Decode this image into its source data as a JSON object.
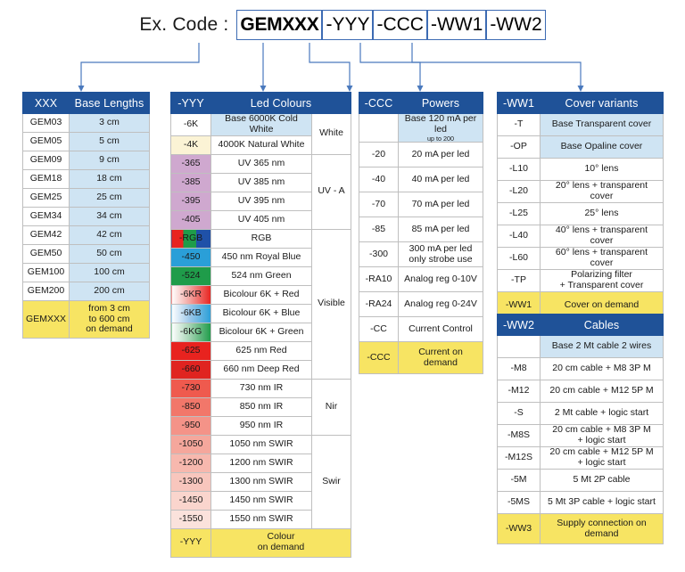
{
  "header": {
    "label": "Ex. Code :",
    "segments": [
      {
        "text": "GEMXXX",
        "bold": true
      },
      {
        "text": "-YYY",
        "bold": false
      },
      {
        "text": "-CCC",
        "bold": false
      },
      {
        "text": "-WW1",
        "bold": false
      },
      {
        "text": "-WW2",
        "bold": false
      }
    ]
  },
  "colors": {
    "header_blue": "#1f5298",
    "light_blue": "#cfe4f3",
    "yellow": "#f7e463",
    "connector_blue": "#3d6bb3",
    "uv_purple": "#cfa8cf",
    "red": "#e8231f",
    "green": "#1f9c4a",
    "blue": "#2a9fd8"
  },
  "tables": {
    "lengths": {
      "headers": [
        "XXX",
        "Base Lengths"
      ],
      "rows": [
        {
          "code": "GEM03",
          "desc": "3 cm"
        },
        {
          "code": "GEM05",
          "desc": "5 cm"
        },
        {
          "code": "GEM09",
          "desc": "9 cm"
        },
        {
          "code": "GEM18",
          "desc": "18 cm"
        },
        {
          "code": "GEM25",
          "desc": "25 cm"
        },
        {
          "code": "GEM34",
          "desc": "34 cm"
        },
        {
          "code": "GEM42",
          "desc": "42 cm"
        },
        {
          "code": "GEM50",
          "desc": "50 cm"
        },
        {
          "code": "GEM100",
          "desc": "100 cm"
        },
        {
          "code": "GEM200",
          "desc": "200 cm"
        }
      ],
      "demand": {
        "code": "GEMXXX",
        "desc": "from 3 cm\nto 600 cm\non demand"
      }
    },
    "colours": {
      "headers": [
        "-YYY",
        "Led Colours"
      ],
      "rows": [
        {
          "code": "-6K",
          "desc": "Base 6000K Cold White"
        },
        {
          "code": "-4K",
          "desc": "4000K Natural White"
        },
        {
          "code": "-365",
          "desc": "UV 365 nm"
        },
        {
          "code": "-385",
          "desc": "UV 385 nm"
        },
        {
          "code": "-395",
          "desc": "UV 395 nm"
        },
        {
          "code": "-405",
          "desc": "UV 405 nm"
        },
        {
          "code": "-RGB",
          "desc": "RGB"
        },
        {
          "code": "-450",
          "desc": "450 nm Royal Blue"
        },
        {
          "code": "-524",
          "desc": "524 nm Green"
        },
        {
          "code": "-6KR",
          "desc": "Bicolour 6K + Red"
        },
        {
          "code": "-6KB",
          "desc": "Bicolour 6K + Blue"
        },
        {
          "code": "-6KG",
          "desc": "Bicolour 6K + Green"
        },
        {
          "code": "-625",
          "desc": "625 nm Red"
        },
        {
          "code": "-660",
          "desc": "660 nm Deep Red"
        },
        {
          "code": "-730",
          "desc": "730 nm IR"
        },
        {
          "code": "-850",
          "desc": "850 nm IR"
        },
        {
          "code": "-950",
          "desc": "950 nm IR"
        },
        {
          "code": "-1050",
          "desc": "1050 nm SWIR"
        },
        {
          "code": "-1200",
          "desc": "1200 nm SWIR"
        },
        {
          "code": "-1300",
          "desc": "1300 nm SWIR"
        },
        {
          "code": "-1450",
          "desc": "1450 nm SWIR"
        },
        {
          "code": "-1550",
          "desc": "1550 nm SWIR"
        }
      ],
      "groups": [
        {
          "label": "White",
          "span": 2
        },
        {
          "label": "UV - A",
          "span": 4
        },
        {
          "label": "Visible",
          "span": 8
        },
        {
          "label": "Nir",
          "span": 3
        },
        {
          "label": "Swir",
          "span": 5
        }
      ],
      "demand": {
        "code": "-YYY",
        "desc": "Colour\non demand"
      }
    },
    "powers": {
      "headers": [
        "-CCC",
        "Powers"
      ],
      "rows": [
        {
          "code": "",
          "desc": "Base 120 mA per led",
          "sub": "up to 200"
        },
        {
          "code": "-20",
          "desc": "20 mA per led"
        },
        {
          "code": "-40",
          "desc": "40 mA per led"
        },
        {
          "code": "-70",
          "desc": "70 mA per led"
        },
        {
          "code": "-85",
          "desc": "85 mA per led"
        },
        {
          "code": "-300",
          "desc": "300 mA per led\nonly strobe use"
        },
        {
          "code": "-RA10",
          "desc": "Analog reg 0-10V"
        },
        {
          "code": "-RA24",
          "desc": "Analog reg 0-24V"
        },
        {
          "code": "-CC",
          "desc": "Current Control"
        }
      ],
      "demand": {
        "code": "-CCC",
        "desc": "Current on\ndemand"
      }
    },
    "covers": {
      "headers": [
        "-WW1",
        "Cover variants"
      ],
      "rows": [
        {
          "code": "-T",
          "desc": "Base Transparent cover"
        },
        {
          "code": "-OP",
          "desc": "Base Opaline cover"
        },
        {
          "code": "-L10",
          "desc": "10° lens"
        },
        {
          "code": "-L20",
          "desc": "20° lens + transparent\ncover"
        },
        {
          "code": "-L25",
          "desc": "25° lens"
        },
        {
          "code": "-L40",
          "desc": "40° lens + transparent\ncover"
        },
        {
          "code": "-L60",
          "desc": "60° lens + transparent\ncover"
        },
        {
          "code": "-TP",
          "desc": "Polarizing filter\n+ Transparent cover"
        }
      ],
      "demand": {
        "code": "-WW1",
        "desc": "Cover on demand"
      }
    },
    "cables": {
      "headers": [
        "-WW2",
        "Cables"
      ],
      "rows": [
        {
          "code": "",
          "desc": "Base 2 Mt cable 2 wires"
        },
        {
          "code": "-M8",
          "desc": "20 cm cable + M8 3P M"
        },
        {
          "code": "-M12",
          "desc": "20 cm cable + M12 5P M"
        },
        {
          "code": "-S",
          "desc": "2 Mt cable + logic start"
        },
        {
          "code": "-M8S",
          "desc": "20 cm cable + M8 3P M\n+ logic start"
        },
        {
          "code": "-M12S",
          "desc": "20 cm cable + M12 5P M\n+ logic start"
        },
        {
          "code": "-5M",
          "desc": "5 Mt 2P cable"
        },
        {
          "code": "-5MS",
          "desc": "5 Mt 3P cable + logic start"
        }
      ],
      "demand": {
        "code": "-WW3",
        "desc": "Supply connection on\ndemand"
      }
    }
  }
}
